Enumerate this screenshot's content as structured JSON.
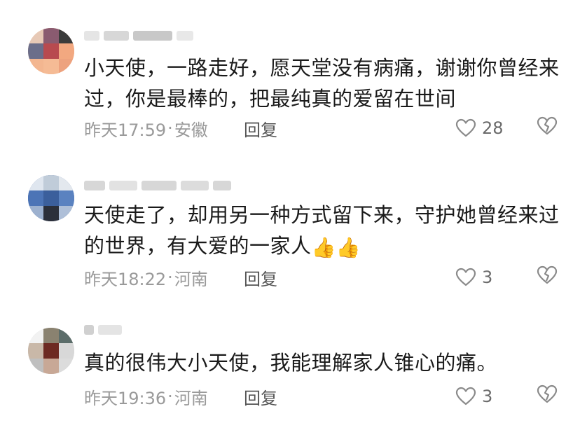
{
  "comments": [
    {
      "text": "小天使，一路走好，愿天堂没有病痛，谢谢你曾经来过，你是最棒的，把最纯真的爱留在世间",
      "time": "昨天17:59",
      "location": "安徽",
      "reply_label": "回复",
      "likes": "28"
    },
    {
      "text": "天使走了，却用另一种方式留下来，守护她曾经来过的世界，有大爱的一家人",
      "emoji": "👍👍",
      "time": "昨天18:22",
      "location": "河南",
      "reply_label": "回复",
      "likes": "3"
    },
    {
      "text": "真的很伟大小天使，我能理解家人锥心的痛。",
      "time": "昨天19:36",
      "location": "河南",
      "reply_label": "回复",
      "likes": "3"
    }
  ],
  "meta_separator": "·"
}
